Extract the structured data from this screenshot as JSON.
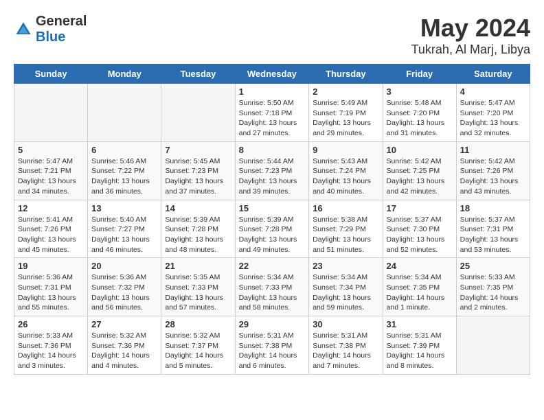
{
  "logo": {
    "general": "General",
    "blue": "Blue"
  },
  "header": {
    "month": "May 2024",
    "location": "Tukrah, Al Marj, Libya"
  },
  "weekdays": [
    "Sunday",
    "Monday",
    "Tuesday",
    "Wednesday",
    "Thursday",
    "Friday",
    "Saturday"
  ],
  "weeks": [
    [
      {
        "day": "",
        "info": ""
      },
      {
        "day": "",
        "info": ""
      },
      {
        "day": "",
        "info": ""
      },
      {
        "day": "1",
        "info": "Sunrise: 5:50 AM\nSunset: 7:18 PM\nDaylight: 13 hours\nand 27 minutes."
      },
      {
        "day": "2",
        "info": "Sunrise: 5:49 AM\nSunset: 7:19 PM\nDaylight: 13 hours\nand 29 minutes."
      },
      {
        "day": "3",
        "info": "Sunrise: 5:48 AM\nSunset: 7:20 PM\nDaylight: 13 hours\nand 31 minutes."
      },
      {
        "day": "4",
        "info": "Sunrise: 5:47 AM\nSunset: 7:20 PM\nDaylight: 13 hours\nand 32 minutes."
      }
    ],
    [
      {
        "day": "5",
        "info": "Sunrise: 5:47 AM\nSunset: 7:21 PM\nDaylight: 13 hours\nand 34 minutes."
      },
      {
        "day": "6",
        "info": "Sunrise: 5:46 AM\nSunset: 7:22 PM\nDaylight: 13 hours\nand 36 minutes."
      },
      {
        "day": "7",
        "info": "Sunrise: 5:45 AM\nSunset: 7:23 PM\nDaylight: 13 hours\nand 37 minutes."
      },
      {
        "day": "8",
        "info": "Sunrise: 5:44 AM\nSunset: 7:23 PM\nDaylight: 13 hours\nand 39 minutes."
      },
      {
        "day": "9",
        "info": "Sunrise: 5:43 AM\nSunset: 7:24 PM\nDaylight: 13 hours\nand 40 minutes."
      },
      {
        "day": "10",
        "info": "Sunrise: 5:42 AM\nSunset: 7:25 PM\nDaylight: 13 hours\nand 42 minutes."
      },
      {
        "day": "11",
        "info": "Sunrise: 5:42 AM\nSunset: 7:26 PM\nDaylight: 13 hours\nand 43 minutes."
      }
    ],
    [
      {
        "day": "12",
        "info": "Sunrise: 5:41 AM\nSunset: 7:26 PM\nDaylight: 13 hours\nand 45 minutes."
      },
      {
        "day": "13",
        "info": "Sunrise: 5:40 AM\nSunset: 7:27 PM\nDaylight: 13 hours\nand 46 minutes."
      },
      {
        "day": "14",
        "info": "Sunrise: 5:39 AM\nSunset: 7:28 PM\nDaylight: 13 hours\nand 48 minutes."
      },
      {
        "day": "15",
        "info": "Sunrise: 5:39 AM\nSunset: 7:28 PM\nDaylight: 13 hours\nand 49 minutes."
      },
      {
        "day": "16",
        "info": "Sunrise: 5:38 AM\nSunset: 7:29 PM\nDaylight: 13 hours\nand 51 minutes."
      },
      {
        "day": "17",
        "info": "Sunrise: 5:37 AM\nSunset: 7:30 PM\nDaylight: 13 hours\nand 52 minutes."
      },
      {
        "day": "18",
        "info": "Sunrise: 5:37 AM\nSunset: 7:31 PM\nDaylight: 13 hours\nand 53 minutes."
      }
    ],
    [
      {
        "day": "19",
        "info": "Sunrise: 5:36 AM\nSunset: 7:31 PM\nDaylight: 13 hours\nand 55 minutes."
      },
      {
        "day": "20",
        "info": "Sunrise: 5:36 AM\nSunset: 7:32 PM\nDaylight: 13 hours\nand 56 minutes."
      },
      {
        "day": "21",
        "info": "Sunrise: 5:35 AM\nSunset: 7:33 PM\nDaylight: 13 hours\nand 57 minutes."
      },
      {
        "day": "22",
        "info": "Sunrise: 5:34 AM\nSunset: 7:33 PM\nDaylight: 13 hours\nand 58 minutes."
      },
      {
        "day": "23",
        "info": "Sunrise: 5:34 AM\nSunset: 7:34 PM\nDaylight: 13 hours\nand 59 minutes."
      },
      {
        "day": "24",
        "info": "Sunrise: 5:34 AM\nSunset: 7:35 PM\nDaylight: 14 hours\nand 1 minute."
      },
      {
        "day": "25",
        "info": "Sunrise: 5:33 AM\nSunset: 7:35 PM\nDaylight: 14 hours\nand 2 minutes."
      }
    ],
    [
      {
        "day": "26",
        "info": "Sunrise: 5:33 AM\nSunset: 7:36 PM\nDaylight: 14 hours\nand 3 minutes."
      },
      {
        "day": "27",
        "info": "Sunrise: 5:32 AM\nSunset: 7:36 PM\nDaylight: 14 hours\nand 4 minutes."
      },
      {
        "day": "28",
        "info": "Sunrise: 5:32 AM\nSunset: 7:37 PM\nDaylight: 14 hours\nand 5 minutes."
      },
      {
        "day": "29",
        "info": "Sunrise: 5:31 AM\nSunset: 7:38 PM\nDaylight: 14 hours\nand 6 minutes."
      },
      {
        "day": "30",
        "info": "Sunrise: 5:31 AM\nSunset: 7:38 PM\nDaylight: 14 hours\nand 7 minutes."
      },
      {
        "day": "31",
        "info": "Sunrise: 5:31 AM\nSunset: 7:39 PM\nDaylight: 14 hours\nand 8 minutes."
      },
      {
        "day": "",
        "info": ""
      }
    ]
  ]
}
